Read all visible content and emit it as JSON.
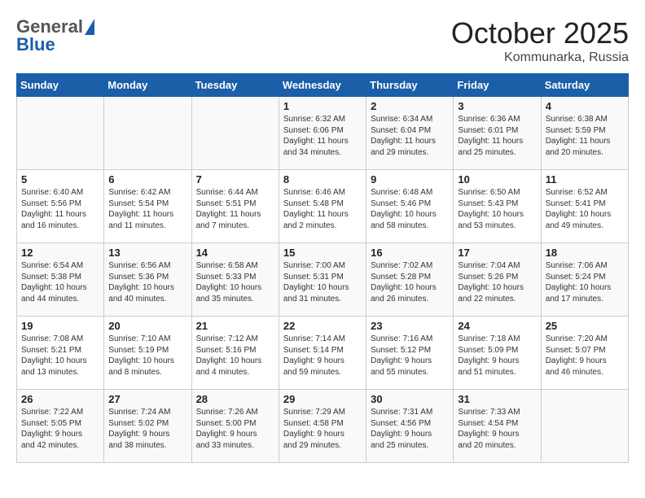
{
  "header": {
    "logo_general": "General",
    "logo_blue": "Blue",
    "month": "October 2025",
    "location": "Kommunarka, Russia"
  },
  "weekdays": [
    "Sunday",
    "Monday",
    "Tuesday",
    "Wednesday",
    "Thursday",
    "Friday",
    "Saturday"
  ],
  "weeks": [
    [
      {
        "day": "",
        "content": ""
      },
      {
        "day": "",
        "content": ""
      },
      {
        "day": "",
        "content": ""
      },
      {
        "day": "1",
        "content": "Sunrise: 6:32 AM\nSunset: 6:06 PM\nDaylight: 11 hours\nand 34 minutes."
      },
      {
        "day": "2",
        "content": "Sunrise: 6:34 AM\nSunset: 6:04 PM\nDaylight: 11 hours\nand 29 minutes."
      },
      {
        "day": "3",
        "content": "Sunrise: 6:36 AM\nSunset: 6:01 PM\nDaylight: 11 hours\nand 25 minutes."
      },
      {
        "day": "4",
        "content": "Sunrise: 6:38 AM\nSunset: 5:59 PM\nDaylight: 11 hours\nand 20 minutes."
      }
    ],
    [
      {
        "day": "5",
        "content": "Sunrise: 6:40 AM\nSunset: 5:56 PM\nDaylight: 11 hours\nand 16 minutes."
      },
      {
        "day": "6",
        "content": "Sunrise: 6:42 AM\nSunset: 5:54 PM\nDaylight: 11 hours\nand 11 minutes."
      },
      {
        "day": "7",
        "content": "Sunrise: 6:44 AM\nSunset: 5:51 PM\nDaylight: 11 hours\nand 7 minutes."
      },
      {
        "day": "8",
        "content": "Sunrise: 6:46 AM\nSunset: 5:48 PM\nDaylight: 11 hours\nand 2 minutes."
      },
      {
        "day": "9",
        "content": "Sunrise: 6:48 AM\nSunset: 5:46 PM\nDaylight: 10 hours\nand 58 minutes."
      },
      {
        "day": "10",
        "content": "Sunrise: 6:50 AM\nSunset: 5:43 PM\nDaylight: 10 hours\nand 53 minutes."
      },
      {
        "day": "11",
        "content": "Sunrise: 6:52 AM\nSunset: 5:41 PM\nDaylight: 10 hours\nand 49 minutes."
      }
    ],
    [
      {
        "day": "12",
        "content": "Sunrise: 6:54 AM\nSunset: 5:38 PM\nDaylight: 10 hours\nand 44 minutes."
      },
      {
        "day": "13",
        "content": "Sunrise: 6:56 AM\nSunset: 5:36 PM\nDaylight: 10 hours\nand 40 minutes."
      },
      {
        "day": "14",
        "content": "Sunrise: 6:58 AM\nSunset: 5:33 PM\nDaylight: 10 hours\nand 35 minutes."
      },
      {
        "day": "15",
        "content": "Sunrise: 7:00 AM\nSunset: 5:31 PM\nDaylight: 10 hours\nand 31 minutes."
      },
      {
        "day": "16",
        "content": "Sunrise: 7:02 AM\nSunset: 5:28 PM\nDaylight: 10 hours\nand 26 minutes."
      },
      {
        "day": "17",
        "content": "Sunrise: 7:04 AM\nSunset: 5:26 PM\nDaylight: 10 hours\nand 22 minutes."
      },
      {
        "day": "18",
        "content": "Sunrise: 7:06 AM\nSunset: 5:24 PM\nDaylight: 10 hours\nand 17 minutes."
      }
    ],
    [
      {
        "day": "19",
        "content": "Sunrise: 7:08 AM\nSunset: 5:21 PM\nDaylight: 10 hours\nand 13 minutes."
      },
      {
        "day": "20",
        "content": "Sunrise: 7:10 AM\nSunset: 5:19 PM\nDaylight: 10 hours\nand 8 minutes."
      },
      {
        "day": "21",
        "content": "Sunrise: 7:12 AM\nSunset: 5:16 PM\nDaylight: 10 hours\nand 4 minutes."
      },
      {
        "day": "22",
        "content": "Sunrise: 7:14 AM\nSunset: 5:14 PM\nDaylight: 9 hours\nand 59 minutes."
      },
      {
        "day": "23",
        "content": "Sunrise: 7:16 AM\nSunset: 5:12 PM\nDaylight: 9 hours\nand 55 minutes."
      },
      {
        "day": "24",
        "content": "Sunrise: 7:18 AM\nSunset: 5:09 PM\nDaylight: 9 hours\nand 51 minutes."
      },
      {
        "day": "25",
        "content": "Sunrise: 7:20 AM\nSunset: 5:07 PM\nDaylight: 9 hours\nand 46 minutes."
      }
    ],
    [
      {
        "day": "26",
        "content": "Sunrise: 7:22 AM\nSunset: 5:05 PM\nDaylight: 9 hours\nand 42 minutes."
      },
      {
        "day": "27",
        "content": "Sunrise: 7:24 AM\nSunset: 5:02 PM\nDaylight: 9 hours\nand 38 minutes."
      },
      {
        "day": "28",
        "content": "Sunrise: 7:26 AM\nSunset: 5:00 PM\nDaylight: 9 hours\nand 33 minutes."
      },
      {
        "day": "29",
        "content": "Sunrise: 7:29 AM\nSunset: 4:58 PM\nDaylight: 9 hours\nand 29 minutes."
      },
      {
        "day": "30",
        "content": "Sunrise: 7:31 AM\nSunset: 4:56 PM\nDaylight: 9 hours\nand 25 minutes."
      },
      {
        "day": "31",
        "content": "Sunrise: 7:33 AM\nSunset: 4:54 PM\nDaylight: 9 hours\nand 20 minutes."
      },
      {
        "day": "",
        "content": ""
      }
    ]
  ]
}
